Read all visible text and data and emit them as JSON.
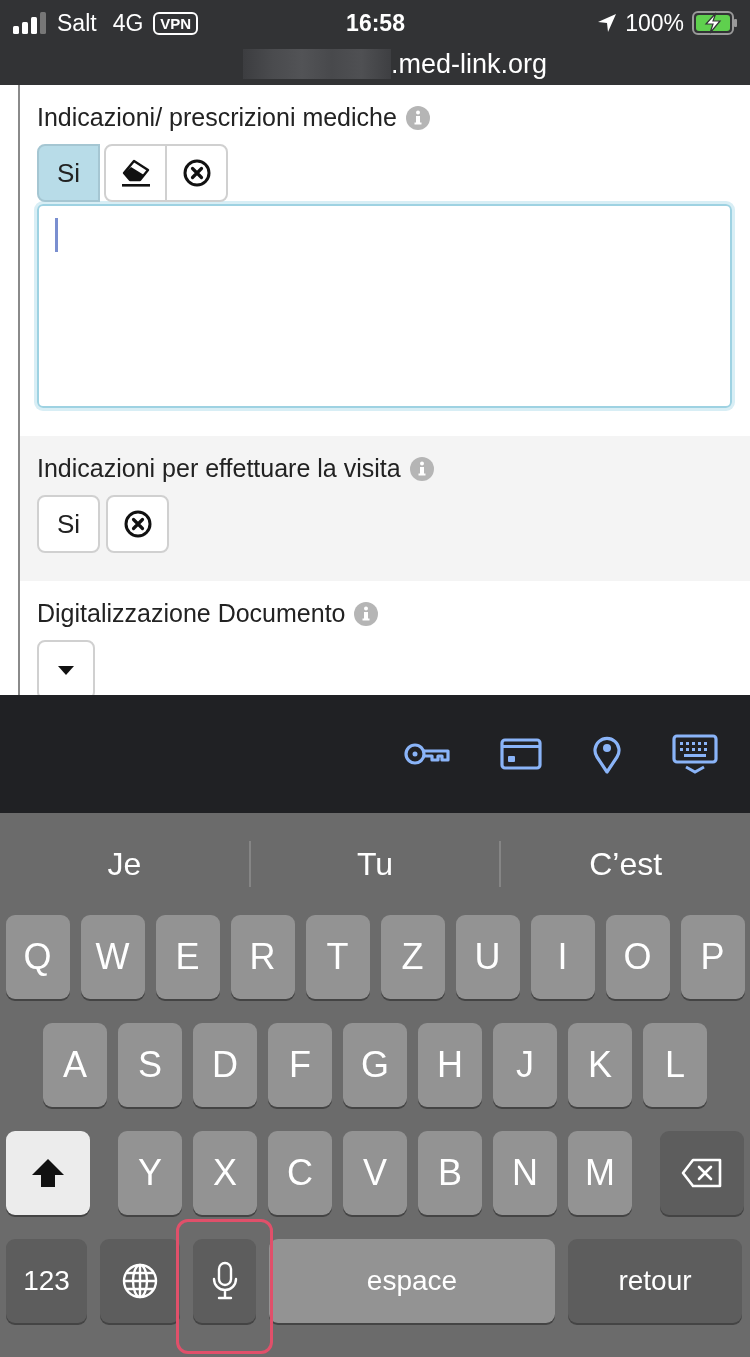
{
  "status_bar": {
    "carrier": "Salt",
    "network": "4G",
    "vpn": "VPN",
    "time": "16:58",
    "battery": "100%",
    "charging": true
  },
  "address_bar": {
    "url": ".med-link.org"
  },
  "form": {
    "sections": [
      {
        "kind": "textarea",
        "label": "Indicazioni/ prescrizioni mediche",
        "grouped": true,
        "buttons": [
          {
            "kind": "text",
            "label": "Si",
            "selected": true
          },
          {
            "kind": "eraser",
            "selected": false
          },
          {
            "kind": "clear",
            "selected": false
          }
        ],
        "focused": true
      },
      {
        "kind": "buttons",
        "label": "Indicazioni per effettuare la visita",
        "grouped": false,
        "buttons": [
          {
            "kind": "text",
            "label": "Si",
            "selected": false
          },
          {
            "kind": "clear",
            "selected": false
          }
        ]
      },
      {
        "kind": "dropdown",
        "label": "Digitalizzazione Documento"
      }
    ]
  },
  "accessory_bar": {
    "tools": [
      {
        "kind": "key"
      },
      {
        "kind": "card"
      },
      {
        "kind": "pin"
      },
      {
        "kind": "keyboard"
      }
    ]
  },
  "keyboard": {
    "suggestions": [
      "Je",
      "Tu",
      "C’est"
    ],
    "letter_rows": [
      [
        "Q",
        "W",
        "E",
        "R",
        "T",
        "Z",
        "U",
        "I",
        "O",
        "P"
      ],
      [
        "A",
        "S",
        "D",
        "F",
        "G",
        "H",
        "J",
        "K",
        "L"
      ],
      [
        "Y",
        "X",
        "C",
        "V",
        "B",
        "N",
        "M"
      ]
    ],
    "shift_on": true,
    "bottom_keys": [
      {
        "kind": "mode",
        "label": "123",
        "highlighted": false
      },
      {
        "kind": "globe",
        "highlighted": false
      },
      {
        "kind": "mic",
        "highlighted": true
      },
      {
        "kind": "space",
        "label": "espace",
        "highlighted": false
      },
      {
        "kind": "return",
        "label": "retour",
        "highlighted": false
      }
    ]
  }
}
